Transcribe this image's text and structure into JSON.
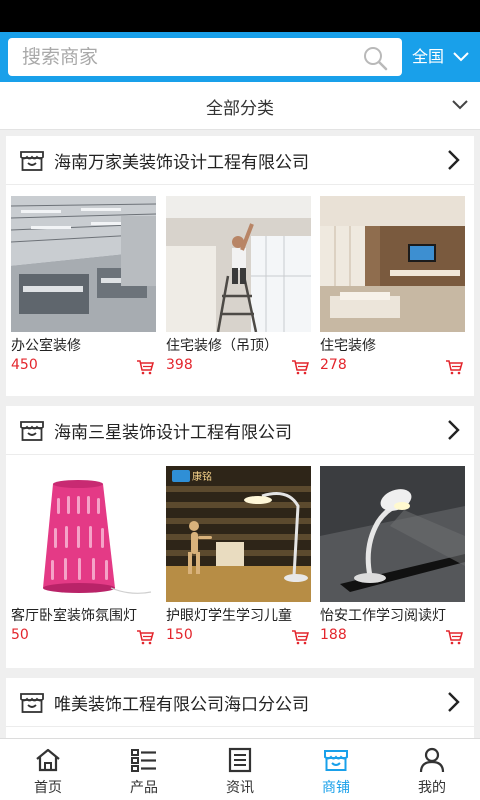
{
  "search": {
    "placeholder": "搜索商家",
    "region": "全国"
  },
  "filter": {
    "label": "全部分类"
  },
  "shops": [
    {
      "name": "海南万家美装饰设计工程有限公司",
      "products": [
        {
          "title": "办公室装修",
          "price": "450"
        },
        {
          "title": "住宅装修（吊顶）",
          "price": "398"
        },
        {
          "title": "住宅装修",
          "price": "278"
        }
      ]
    },
    {
      "name": "海南三星装饰设计工程有限公司",
      "products": [
        {
          "title": "客厅卧室装饰氛围灯",
          "price": "50"
        },
        {
          "title": "护眼灯学生学习儿童",
          "price": "150"
        },
        {
          "title": "怡安工作学习阅读灯",
          "price": "188"
        }
      ]
    },
    {
      "name": "唯美装饰工程有限公司海口分公司"
    }
  ],
  "nav": [
    {
      "label": "首页",
      "icon": "home-icon"
    },
    {
      "label": "产品",
      "icon": "list-icon"
    },
    {
      "label": "资讯",
      "icon": "news-icon"
    },
    {
      "label": "商铺",
      "icon": "shop-icon",
      "active": true
    },
    {
      "label": "我的",
      "icon": "user-icon"
    }
  ],
  "photo_texts": {
    "brand": "康铭"
  },
  "colors": {
    "accent": "#19a0ea",
    "price": "#e3262d"
  }
}
